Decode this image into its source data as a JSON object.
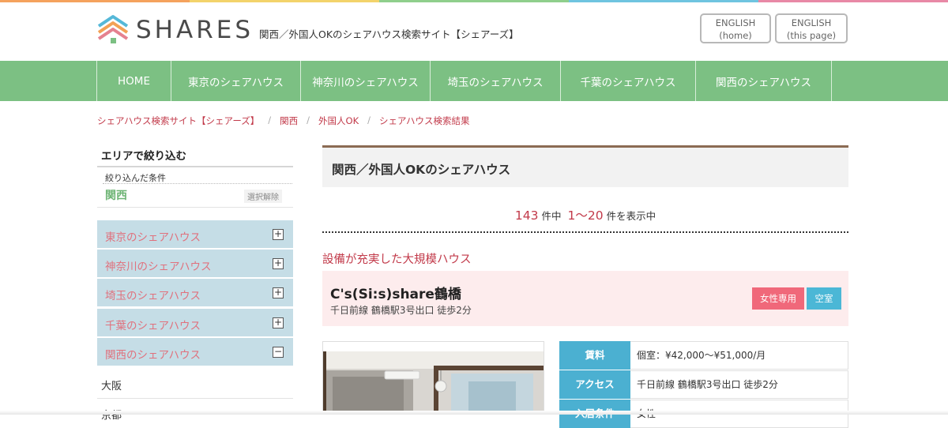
{
  "colors": {
    "nav_green": "#7cc083",
    "accent_red": "#c23a4a",
    "sidebar_blue": "#c5dde6",
    "sidebar_text_pink": "#e0717d",
    "info_blue": "#4bb0d1",
    "badge_pink": "#f0687a",
    "badge_cyan": "#4bb7d6",
    "card_pink": "#fdeced",
    "heading_border_brown": "#8b6b53"
  },
  "header": {
    "logo_text": "SHARES",
    "tagline": "関西／外国人OKのシェアハウス検索サイト【シェアーズ】",
    "lang_home": {
      "line1": "ENGLISH",
      "line2": "(home)"
    },
    "lang_page": {
      "line1": "ENGLISH",
      "line2": "(this page)"
    }
  },
  "nav": {
    "items": [
      {
        "label": "HOME"
      },
      {
        "label": "東京のシェアハウス"
      },
      {
        "label": "神奈川のシェアハウス"
      },
      {
        "label": "埼玉のシェアハウス"
      },
      {
        "label": "千葉のシェアハウス"
      },
      {
        "label": "関西のシェアハウス"
      }
    ]
  },
  "breadcrumb": {
    "items": [
      {
        "label": "シェアハウス検索サイト【シェアーズ】"
      },
      {
        "label": "関西"
      },
      {
        "label": "外国人OK"
      },
      {
        "label": "シェアハウス検索結果"
      }
    ],
    "separator": "/"
  },
  "sidebar": {
    "title": "エリアで絞り込む",
    "condition_label": "絞り込んだ条件",
    "condition_value": "関西",
    "clear_label": "選択解除",
    "areas": [
      {
        "label": "東京のシェアハウス",
        "toggle": "+"
      },
      {
        "label": "神奈川のシェアハウス",
        "toggle": "+"
      },
      {
        "label": "埼玉のシェアハウス",
        "toggle": "+"
      },
      {
        "label": "千葉のシェアハウス",
        "toggle": "+"
      },
      {
        "label": "関西のシェアハウス",
        "toggle": "−"
      }
    ],
    "sub_items": [
      {
        "label": "大阪"
      },
      {
        "label": "京都"
      }
    ]
  },
  "main": {
    "heading": "関西／外国人OKのシェアハウス",
    "result": {
      "total": "143",
      "unit1": "件中",
      "range": "1〜20",
      "unit2": "件を表示中"
    },
    "section_title": "設備が充実した大規模ハウス",
    "property": {
      "name": "C's(Si:s)share鶴橋",
      "access": "千日前線 鶴橋駅3号出口 徒歩2分",
      "badges": [
        "女性専用",
        "空室"
      ],
      "info": [
        {
          "key": "賃料",
          "value": "個室：¥42,000〜¥51,000/月"
        },
        {
          "key": "アクセス",
          "value": "千日前線 鶴橋駅3号出口 徒歩2分"
        },
        {
          "key": "入居条件",
          "value": "女性"
        }
      ]
    }
  }
}
